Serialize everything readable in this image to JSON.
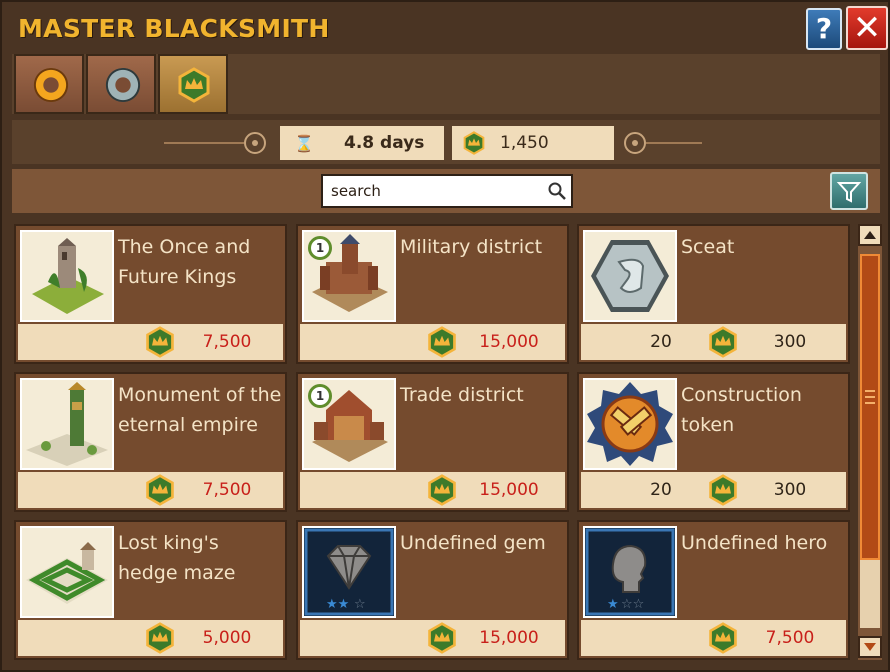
{
  "window": {
    "title": "MASTER BLACKSMITH",
    "help_label": "?",
    "close_label": "✕"
  },
  "tabs": [
    {
      "icon": "gold-horseshoe-icon",
      "active": false
    },
    {
      "icon": "silver-horseshoe-icon",
      "active": false
    },
    {
      "icon": "crown-token-icon",
      "active": true
    }
  ],
  "filters": {
    "duration": "4.8 days",
    "currency_amount": "1,450"
  },
  "search": {
    "placeholder": "search"
  },
  "items": [
    {
      "name": "The Once and Future Kings",
      "image": "tower-ruin",
      "price": "7,500"
    },
    {
      "name": "Military district",
      "image": "castle-district",
      "level": "1",
      "price": "15,000"
    },
    {
      "name": "Sceat",
      "image": "silver-coin",
      "qty": "20",
      "price": "300"
    },
    {
      "name": "Monument of the eternal empire",
      "image": "monument",
      "price": "7,500"
    },
    {
      "name": "Trade district",
      "image": "trade-district",
      "level": "1",
      "price": "15,000"
    },
    {
      "name": "Construction token",
      "image": "construction-token",
      "qty": "20",
      "price": "300"
    },
    {
      "name": "Lost king's hedge maze",
      "image": "hedge-maze",
      "price": "5,000"
    },
    {
      "name": "Undefined gem",
      "image": "gem",
      "stars": 2,
      "price": "15,000"
    },
    {
      "name": "Undefined hero",
      "image": "hero",
      "stars": 1,
      "price": "7,500"
    }
  ],
  "colors": {
    "title": "#f1b42e",
    "price": "#c8201a",
    "panel": "#754b2e"
  }
}
